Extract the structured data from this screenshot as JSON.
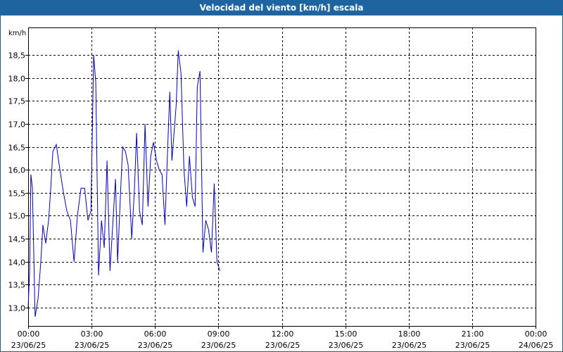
{
  "window": {
    "title": "Velocidad del viento [km/h] escala"
  },
  "chart_data": {
    "type": "line",
    "title": "Velocidad del viento [km/h] escala",
    "ylabel": "km/h",
    "xlabel": "",
    "ylim": [
      12.6,
      19.1
    ],
    "xlim_hours": [
      0,
      24
    ],
    "grid": true,
    "line_color": "#0000c8",
    "y_ticks": [
      "13,0",
      "13,5",
      "14,0",
      "14,5",
      "15,0",
      "15,5",
      "16,0",
      "16,5",
      "17,0",
      "17,5",
      "18,0",
      "18,5"
    ],
    "y_tick_values": [
      13.0,
      13.5,
      14.0,
      14.5,
      15.0,
      15.5,
      16.0,
      16.5,
      17.0,
      17.5,
      18.0,
      18.5
    ],
    "x_ticks": [
      {
        "hours": 0,
        "time": "00:00",
        "date": "23/06/25"
      },
      {
        "hours": 3,
        "time": "03:00",
        "date": "23/06/25"
      },
      {
        "hours": 6,
        "time": "06:00",
        "date": "23/06/25"
      },
      {
        "hours": 9,
        "time": "09:00",
        "date": "23/06/25"
      },
      {
        "hours": 12,
        "time": "12:00",
        "date": "23/06/25"
      },
      {
        "hours": 15,
        "time": "15:00",
        "date": "23/06/25"
      },
      {
        "hours": 18,
        "time": "18:00",
        "date": "23/06/25"
      },
      {
        "hours": 21,
        "time": "21:00",
        "date": "23/06/25"
      },
      {
        "hours": 24,
        "time": "00:00",
        "date": "24/06/25"
      }
    ],
    "series": [
      {
        "points": [
          [
            0.0,
            13.0
          ],
          [
            0.07,
            13.8
          ],
          [
            0.13,
            15.9
          ],
          [
            0.2,
            15.6
          ],
          [
            0.33,
            12.8
          ],
          [
            0.47,
            13.2
          ],
          [
            0.6,
            14.0
          ],
          [
            0.7,
            14.8
          ],
          [
            0.83,
            14.4
          ],
          [
            0.97,
            14.9
          ],
          [
            1.07,
            15.6
          ],
          [
            1.17,
            16.4
          ],
          [
            1.33,
            16.55
          ],
          [
            1.5,
            16.0
          ],
          [
            1.67,
            15.5
          ],
          [
            1.83,
            15.1
          ],
          [
            2.0,
            14.9
          ],
          [
            2.17,
            14.0
          ],
          [
            2.33,
            15.0
          ],
          [
            2.5,
            15.6
          ],
          [
            2.67,
            15.6
          ],
          [
            2.83,
            14.9
          ],
          [
            2.97,
            15.1
          ],
          [
            3.1,
            18.5
          ],
          [
            3.2,
            17.9
          ],
          [
            3.33,
            13.7
          ],
          [
            3.47,
            14.9
          ],
          [
            3.6,
            14.3
          ],
          [
            3.73,
            16.2
          ],
          [
            3.87,
            13.8
          ],
          [
            4.0,
            14.8
          ],
          [
            4.13,
            15.8
          ],
          [
            4.23,
            14.0
          ],
          [
            4.37,
            15.5
          ],
          [
            4.47,
            16.5
          ],
          [
            4.6,
            16.4
          ],
          [
            4.73,
            16.1
          ],
          [
            4.9,
            14.5
          ],
          [
            5.03,
            15.6
          ],
          [
            5.13,
            16.8
          ],
          [
            5.27,
            15.1
          ],
          [
            5.4,
            14.8
          ],
          [
            5.53,
            17.0
          ],
          [
            5.67,
            15.2
          ],
          [
            5.8,
            16.3
          ],
          [
            5.93,
            16.6
          ],
          [
            6.07,
            16.2
          ],
          [
            6.2,
            16.0
          ],
          [
            6.33,
            15.9
          ],
          [
            6.47,
            14.8
          ],
          [
            6.6,
            16.5
          ],
          [
            6.7,
            17.7
          ],
          [
            6.8,
            16.2
          ],
          [
            7.0,
            17.4
          ],
          [
            7.1,
            18.6
          ],
          [
            7.23,
            18.1
          ],
          [
            7.37,
            16.0
          ],
          [
            7.5,
            15.2
          ],
          [
            7.63,
            16.3
          ],
          [
            7.77,
            15.4
          ],
          [
            7.9,
            15.2
          ],
          [
            8.0,
            17.8
          ],
          [
            8.13,
            18.15
          ],
          [
            8.27,
            14.2
          ],
          [
            8.4,
            14.9
          ],
          [
            8.53,
            14.7
          ],
          [
            8.67,
            14.2
          ],
          [
            8.8,
            15.7
          ],
          [
            8.93,
            14.0
          ],
          [
            9.07,
            13.8
          ]
        ]
      }
    ]
  }
}
